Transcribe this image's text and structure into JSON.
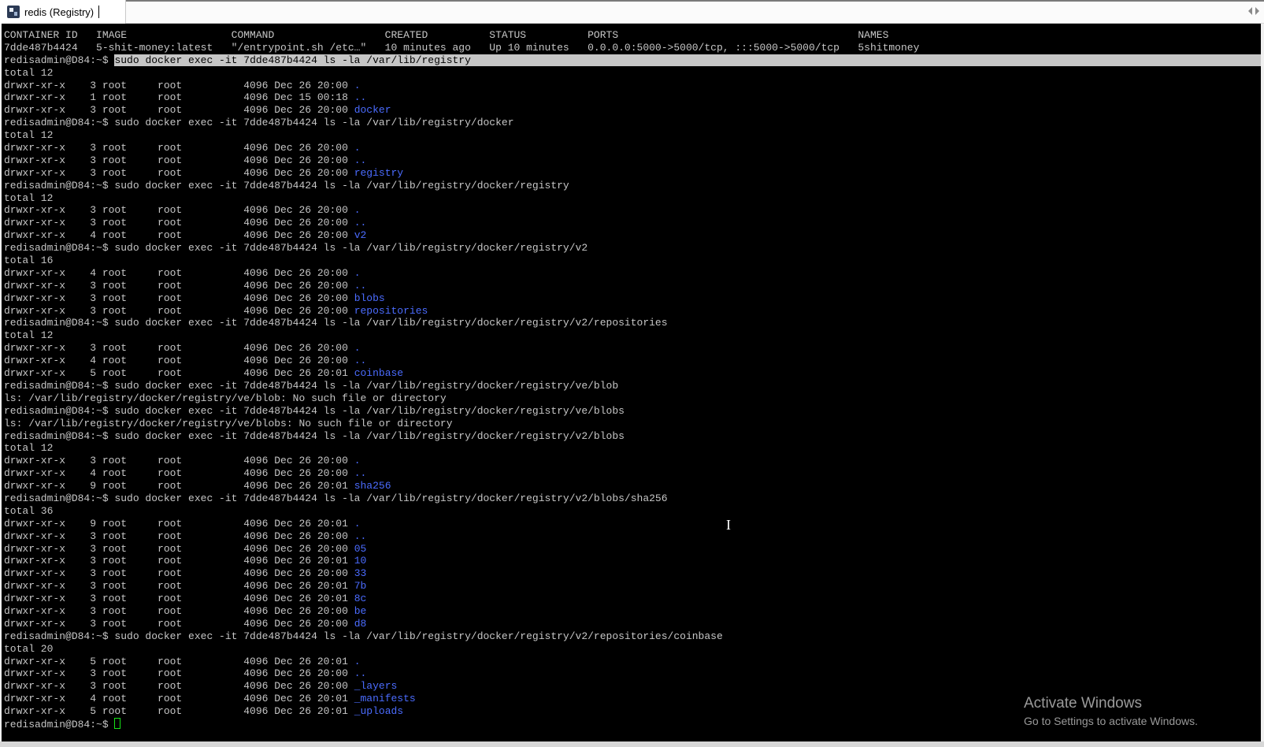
{
  "window": {
    "tab_title": "redis (Registry)",
    "tab_icon": "putty-terminal-icon"
  },
  "terminal": {
    "colors": {
      "background": "#000000",
      "text": "#c6c6c6",
      "directory": "#4b6cff",
      "cursor": "#17e317"
    },
    "lines": [
      {
        "text": "CONTAINER ID   IMAGE                 COMMAND                  CREATED          STATUS          PORTS                                       NAMES"
      },
      {
        "text": "7dde487b4424   5-shit-money:latest   \"/entrypoint.sh /etc…\"   10 minutes ago   Up 10 minutes   0.0.0.0:5000->5000/tcp, :::5000->5000/tcp   5shitmoney"
      },
      {
        "prompt": "redisadmin@D84:~$ ",
        "cmd": "sudo docker exec -it 7dde487b4424 ls -la /var/lib/registry",
        "selected": true
      },
      {
        "text": "total 12"
      },
      {
        "text": "drwxr-xr-x    3 root     root          4096 Dec 26 20:00 ",
        "dir": "."
      },
      {
        "text": "drwxr-xr-x    1 root     root          4096 Dec 15 00:18 ",
        "dir": ".."
      },
      {
        "text": "drwxr-xr-x    3 root     root          4096 Dec 26 20:00 ",
        "dir": "docker"
      },
      {
        "text": "redisadmin@D84:~$ sudo docker exec -it 7dde487b4424 ls -la /var/lib/registry/docker"
      },
      {
        "text": "total 12"
      },
      {
        "text": "drwxr-xr-x    3 root     root          4096 Dec 26 20:00 ",
        "dir": "."
      },
      {
        "text": "drwxr-xr-x    3 root     root          4096 Dec 26 20:00 ",
        "dir": ".."
      },
      {
        "text": "drwxr-xr-x    3 root     root          4096 Dec 26 20:00 ",
        "dir": "registry"
      },
      {
        "text": "redisadmin@D84:~$ sudo docker exec -it 7dde487b4424 ls -la /var/lib/registry/docker/registry"
      },
      {
        "text": "total 12"
      },
      {
        "text": "drwxr-xr-x    3 root     root          4096 Dec 26 20:00 ",
        "dir": "."
      },
      {
        "text": "drwxr-xr-x    3 root     root          4096 Dec 26 20:00 ",
        "dir": ".."
      },
      {
        "text": "drwxr-xr-x    4 root     root          4096 Dec 26 20:00 ",
        "dir": "v2"
      },
      {
        "text": "redisadmin@D84:~$ sudo docker exec -it 7dde487b4424 ls -la /var/lib/registry/docker/registry/v2"
      },
      {
        "text": "total 16"
      },
      {
        "text": "drwxr-xr-x    4 root     root          4096 Dec 26 20:00 ",
        "dir": "."
      },
      {
        "text": "drwxr-xr-x    3 root     root          4096 Dec 26 20:00 ",
        "dir": ".."
      },
      {
        "text": "drwxr-xr-x    3 root     root          4096 Dec 26 20:00 ",
        "dir": "blobs"
      },
      {
        "text": "drwxr-xr-x    3 root     root          4096 Dec 26 20:00 ",
        "dir": "repositories"
      },
      {
        "text": "redisadmin@D84:~$ sudo docker exec -it 7dde487b4424 ls -la /var/lib/registry/docker/registry/v2/repositories"
      },
      {
        "text": "total 12"
      },
      {
        "text": "drwxr-xr-x    3 root     root          4096 Dec 26 20:00 ",
        "dir": "."
      },
      {
        "text": "drwxr-xr-x    4 root     root          4096 Dec 26 20:00 ",
        "dir": ".."
      },
      {
        "text": "drwxr-xr-x    5 root     root          4096 Dec 26 20:01 ",
        "dir": "coinbase"
      },
      {
        "text": "redisadmin@D84:~$ sudo docker exec -it 7dde487b4424 ls -la /var/lib/registry/docker/registry/ve/blob"
      },
      {
        "text": "ls: /var/lib/registry/docker/registry/ve/blob: No such file or directory"
      },
      {
        "text": "redisadmin@D84:~$ sudo docker exec -it 7dde487b4424 ls -la /var/lib/registry/docker/registry/ve/blobs"
      },
      {
        "text": "ls: /var/lib/registry/docker/registry/ve/blobs: No such file or directory"
      },
      {
        "text": "redisadmin@D84:~$ sudo docker exec -it 7dde487b4424 ls -la /var/lib/registry/docker/registry/v2/blobs"
      },
      {
        "text": "total 12"
      },
      {
        "text": "drwxr-xr-x    3 root     root          4096 Dec 26 20:00 ",
        "dir": "."
      },
      {
        "text": "drwxr-xr-x    4 root     root          4096 Dec 26 20:00 ",
        "dir": ".."
      },
      {
        "text": "drwxr-xr-x    9 root     root          4096 Dec 26 20:01 ",
        "dir": "sha256"
      },
      {
        "text": "redisadmin@D84:~$ sudo docker exec -it 7dde487b4424 ls -la /var/lib/registry/docker/registry/v2/blobs/sha256"
      },
      {
        "text": "total 36"
      },
      {
        "text": "drwxr-xr-x    9 root     root          4096 Dec 26 20:01 ",
        "dir": "."
      },
      {
        "text": "drwxr-xr-x    3 root     root          4096 Dec 26 20:00 ",
        "dir": ".."
      },
      {
        "text": "drwxr-xr-x    3 root     root          4096 Dec 26 20:00 ",
        "dir": "05"
      },
      {
        "text": "drwxr-xr-x    3 root     root          4096 Dec 26 20:01 ",
        "dir": "10"
      },
      {
        "text": "drwxr-xr-x    3 root     root          4096 Dec 26 20:00 ",
        "dir": "33"
      },
      {
        "text": "drwxr-xr-x    3 root     root          4096 Dec 26 20:01 ",
        "dir": "7b"
      },
      {
        "text": "drwxr-xr-x    3 root     root          4096 Dec 26 20:01 ",
        "dir": "8c"
      },
      {
        "text": "drwxr-xr-x    3 root     root          4096 Dec 26 20:00 ",
        "dir": "be"
      },
      {
        "text": "drwxr-xr-x    3 root     root          4096 Dec 26 20:00 ",
        "dir": "d8"
      },
      {
        "text": "redisadmin@D84:~$ sudo docker exec -it 7dde487b4424 ls -la /var/lib/registry/docker/registry/v2/repositories/coinbase"
      },
      {
        "text": "total 20"
      },
      {
        "text": "drwxr-xr-x    5 root     root          4096 Dec 26 20:01 ",
        "dir": "."
      },
      {
        "text": "drwxr-xr-x    3 root     root          4096 Dec 26 20:00 ",
        "dir": ".."
      },
      {
        "text": "drwxr-xr-x    3 root     root          4096 Dec 26 20:00 ",
        "dir": "_layers"
      },
      {
        "text": "drwxr-xr-x    4 root     root          4096 Dec 26 20:01 ",
        "dir": "_manifests"
      },
      {
        "text": "drwxr-xr-x    5 root     root          4096 Dec 26 20:01 ",
        "dir": "_uploads"
      },
      {
        "text": "redisadmin@D84:~$ ",
        "cursor": true
      }
    ]
  },
  "watermark": {
    "title": "Activate Windows",
    "subtitle": "Go to Settings to activate Windows."
  }
}
